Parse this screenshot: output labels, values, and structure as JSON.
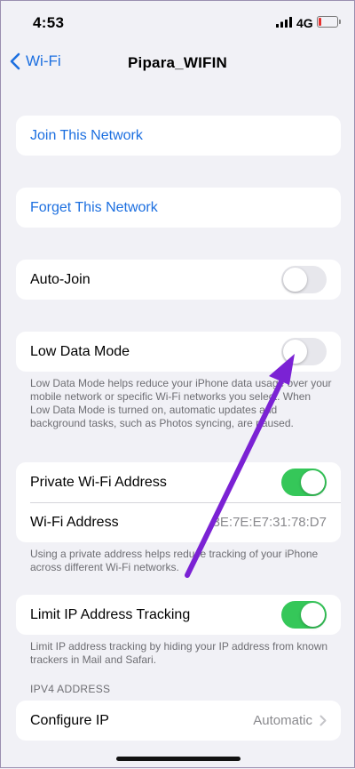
{
  "status_bar": {
    "time": "4:53",
    "network": "4G",
    "battery_color": "#e5302d",
    "battery_level": 0.15
  },
  "nav": {
    "back_label": "Wi-Fi",
    "title": "Pipara_WIFIN"
  },
  "actions": {
    "join": "Join This Network",
    "forget": "Forget This Network"
  },
  "auto_join": {
    "label": "Auto-Join",
    "on": false
  },
  "low_data": {
    "label": "Low Data Mode",
    "on": false,
    "footnote": "Low Data Mode helps reduce your iPhone data usage over your mobile network or specific Wi-Fi networks you select. When Low Data Mode is turned on, automatic updates and background tasks, such as Photos syncing, are paused."
  },
  "private_address": {
    "label": "Private Wi-Fi Address",
    "on": true,
    "address_label": "Wi-Fi Address",
    "address_value": "3E:7E:E7:31:78:D7",
    "footnote": "Using a private address helps reduce tracking of your iPhone across different Wi-Fi networks."
  },
  "limit_ip": {
    "label": "Limit IP Address Tracking",
    "on": true,
    "footnote": "Limit IP address tracking by hiding your IP address from known trackers in Mail and Safari."
  },
  "ipv4": {
    "header": "IPV4 ADDRESS",
    "configure_label": "Configure IP",
    "configure_value": "Automatic"
  },
  "colors": {
    "accent": "#1c6fe0",
    "toggle_on": "#35c759",
    "annotation_arrow": "#7b22d4"
  }
}
